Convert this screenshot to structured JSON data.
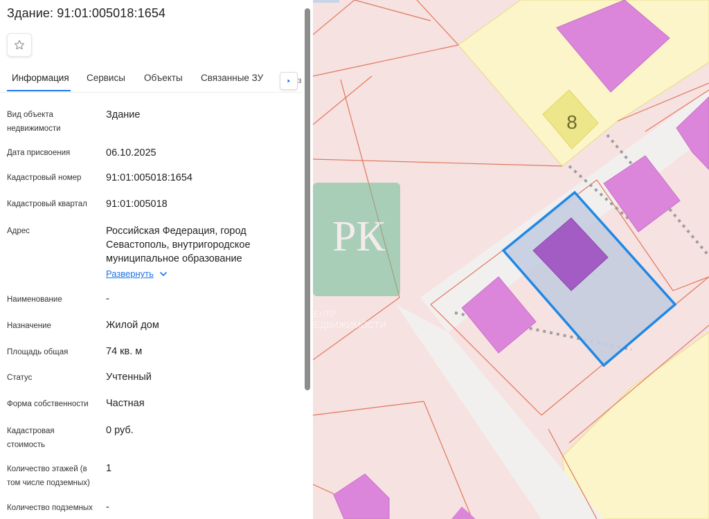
{
  "header": {
    "title": "Здание: 91:01:005018:1654",
    "favorite_icon": "star-icon"
  },
  "tabs": [
    {
      "label": "Информация",
      "active": true
    },
    {
      "label": "Сервисы",
      "active": false
    },
    {
      "label": "Объекты",
      "active": false
    },
    {
      "label": "Связанные ЗУ",
      "active": false
    }
  ],
  "tabs_more_icon": "chevron-right-icon",
  "tabs_overflow_text": "з",
  "properties": [
    {
      "label": "Вид объекта недвижимости",
      "value": "Здание"
    },
    {
      "label": "Дата присвоения",
      "value": "06.10.2025"
    },
    {
      "label": "Кадастровый номер",
      "value": "91:01:005018:1654"
    },
    {
      "label": "Кадастровый квартал",
      "value": "91:01:005018"
    },
    {
      "label": "Адрес",
      "value": "Российская Федерация, город Севастополь, внутригородское муниципальное образование"
    },
    {
      "label": "Наименование",
      "value": "-"
    },
    {
      "label": "Назначение",
      "value": "Жилой дом"
    },
    {
      "label": "Площадь общая",
      "value": "74 кв. м"
    },
    {
      "label": "Статус",
      "value": "Учтенный"
    },
    {
      "label": "Форма собственности",
      "value": "Частная"
    },
    {
      "label": "Кадастровая стоимость",
      "value": "0 руб."
    },
    {
      "label": "Количество этажей (в том числе подземных)",
      "value": "1"
    },
    {
      "label": "Количество подземных",
      "value": "-"
    }
  ],
  "address_expand": {
    "label": "Развернуть",
    "icon": "chevron-down-icon"
  },
  "map": {
    "house_number": "8",
    "watermark_letters": "РК",
    "watermark_line1": "ЦЕНТР",
    "watermark_line2": "НЕДВИЖИМОСТИ",
    "colors": {
      "parcel_fill": "#f6e2e1",
      "parcel_border": "#e0765c",
      "yellow_area": "#fbf5c9",
      "building_fill": "#db86db",
      "selected_outline": "#1e88e5",
      "selected_fill": "#c5cde0",
      "selected_building": "#a25cc4",
      "road": "#f1f0ef",
      "watermark": "#6cbf98"
    }
  }
}
